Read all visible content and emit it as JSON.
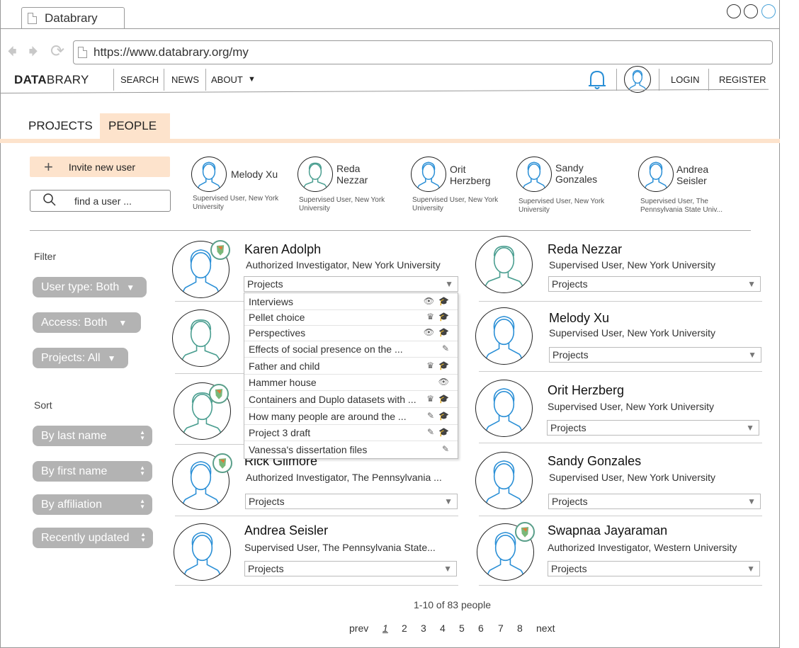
{
  "browser": {
    "tab_title": "Databrary",
    "url": "https://www.databrary.org/my"
  },
  "header": {
    "logo_bold": "DATA",
    "logo_rest": "BRARY",
    "nav": [
      "SEARCH",
      "NEWS",
      "ABOUT"
    ],
    "login": "LOGIN",
    "register": "REGISTER"
  },
  "tabs": [
    "PROJECTS",
    "PEOPLE"
  ],
  "sidebar": {
    "invite_label": "Invite new user",
    "find_placeholder": "find a user ...",
    "filter_label": "Filter",
    "filters": [
      "User type: Both",
      "Access: Both",
      "Projects: All"
    ],
    "sort_label": "Sort",
    "sorts": [
      "By last name",
      "By first name",
      "By affiliation",
      "Recently updated"
    ]
  },
  "recent_users": [
    {
      "name": "Melody Xu",
      "affiliation": "Supervised User, New York University"
    },
    {
      "name": "Reda Nezzar",
      "affiliation": "Supervised User, New York University"
    },
    {
      "name": "Orit Herzberg",
      "affiliation": "Supervised User, New York University"
    },
    {
      "name": "Sandy Gonzales",
      "affiliation": "Supervised User, New York University"
    },
    {
      "name": "Andrea Seisler",
      "affiliation": "Supervised User, The Pennsylvania State Univ..."
    }
  ],
  "people": [
    {
      "name": "Karen Adolph",
      "affiliation": "Authorized Investigator, New York University",
      "projects": "Projects"
    },
    {
      "name": "Reda Nezzar",
      "affiliation": "Supervised User, New York University",
      "projects": "Projects"
    },
    {
      "name": "Melody Xu",
      "affiliation": "Supervised User, New York University",
      "projects": "Projects"
    },
    {
      "name": "Orit Herzberg",
      "affiliation": "Supervised User, New York University",
      "projects": "Projects"
    },
    {
      "name": "Rick Gilmore",
      "affiliation": "Authorized Investigator, The Pennsylvania ...",
      "projects": "Projects"
    },
    {
      "name": "Sandy Gonzales",
      "affiliation": "Supervised User, New York University",
      "projects": "Projects"
    },
    {
      "name": "Andrea Seisler",
      "affiliation": "Supervised User, The Pennsylvania State...",
      "projects": "Projects"
    },
    {
      "name": "Swapnaa Jayaraman",
      "affiliation": "Authorized Investigator, Western University",
      "projects": "Projects"
    }
  ],
  "dropdown": [
    {
      "label": "Interviews",
      "icons": "eye-icon graduation-cap-icon"
    },
    {
      "label": "Pellet choice",
      "icons": "crown-icon graduation-cap-icon"
    },
    {
      "label": "Perspectives",
      "icons": "eye-icon graduation-cap-icon"
    },
    {
      "label": "Effects of social presence on the ...",
      "icons": "pencil-icon"
    },
    {
      "label": "Father and child",
      "icons": "crown-icon graduation-cap-icon"
    },
    {
      "label": "Hammer house",
      "icons": "eye-icon"
    },
    {
      "label": "Containers and Duplo datasets with ...",
      "icons": "crown-icon graduation-cap-icon"
    },
    {
      "label": "How many people are around the ...",
      "icons": "pencil-icon graduation-cap-icon"
    },
    {
      "label": "Project 3 draft",
      "icons": "pencil-icon graduation-cap-icon"
    },
    {
      "label": "Vanessa's dissertation files",
      "icons": "pencil-icon"
    }
  ],
  "pagination": {
    "count": "1-10 of 83 people",
    "prev": "prev",
    "pages": [
      "1",
      "2",
      "3",
      "4",
      "5",
      "6",
      "7",
      "8"
    ],
    "next": "next"
  }
}
